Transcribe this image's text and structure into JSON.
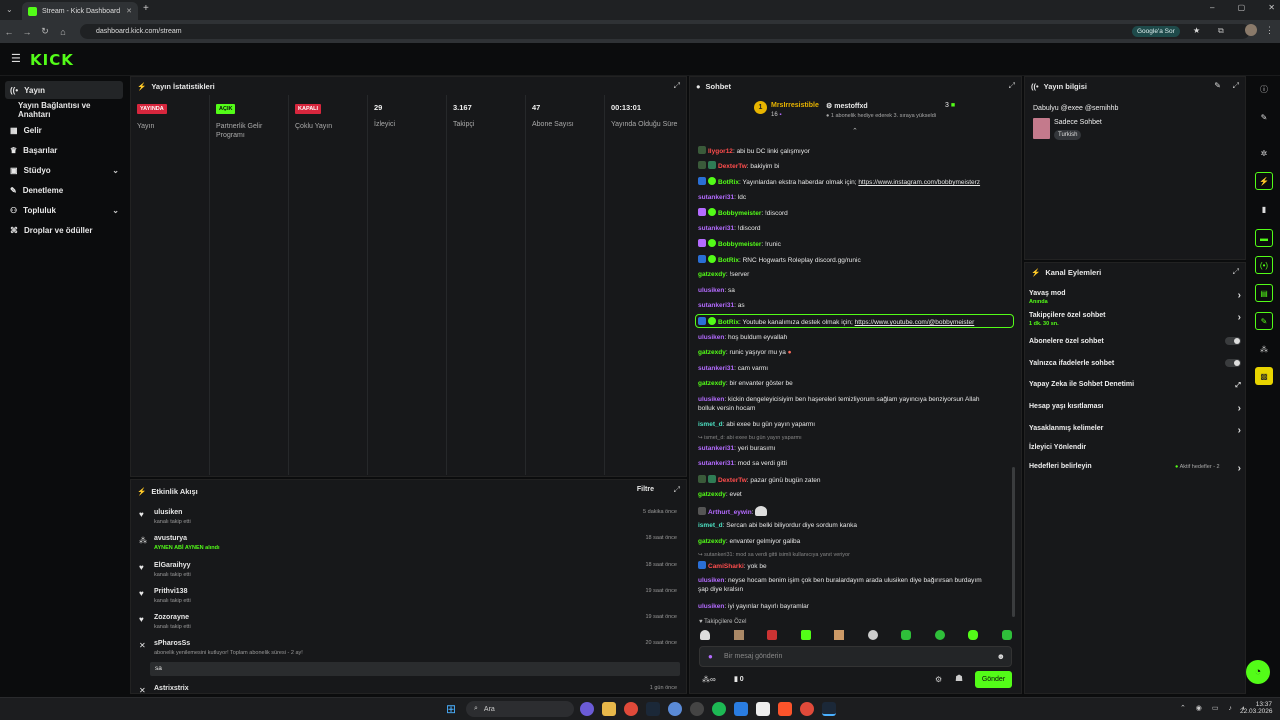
{
  "browser": {
    "tab_title": "Stream - Kick Dashboard",
    "url": "dashboard.kick.com/stream",
    "google_label": "Google'a Sor"
  },
  "header": {
    "logo": "KICK"
  },
  "sidebar": {
    "items": [
      {
        "label": "Yayın",
        "icon": "broadcast-icon"
      },
      {
        "label": "Yayın Bağlantısı ve Anahtarı",
        "icon": ""
      },
      {
        "label": "Gelir",
        "icon": "revenue-icon"
      },
      {
        "label": "Başarılar",
        "icon": "trophy-icon"
      },
      {
        "label": "Stüdyo",
        "icon": "studio-icon"
      },
      {
        "label": "Denetleme",
        "icon": "wrench-icon"
      },
      {
        "label": "Topluluk",
        "icon": "community-icon"
      },
      {
        "label": "Droplar ve ödüller",
        "icon": "gift-icon"
      }
    ]
  },
  "stats": {
    "title": "Yayın İstatistikleri",
    "items": [
      {
        "value": "YAYINDA",
        "label": "Yayın",
        "kind": "red"
      },
      {
        "value": "AÇIK",
        "label": "Partnerlik Gelir Programı",
        "kind": "green"
      },
      {
        "value": "KAPALI",
        "label": "Çoklu Yayın",
        "kind": "red"
      },
      {
        "value": "29",
        "label": "İzleyici",
        "kind": "num"
      },
      {
        "value": "3.167",
        "label": "Takipçi",
        "kind": "num"
      },
      {
        "value": "47",
        "label": "Abone Sayısı",
        "kind": "num"
      },
      {
        "value": "00:13:01",
        "label": "Yayında Olduğu Süre",
        "kind": "num"
      }
    ]
  },
  "activity": {
    "title": "Etkinlik Akışı",
    "filter": "Filtre",
    "items": [
      {
        "user": "ulusiken",
        "sub": "kanalı takip etti",
        "time": "5 dakika önce",
        "icon": "heart-icon"
      },
      {
        "user": "avusturya",
        "sub": "AYNEN ABİ AYNEN alındı",
        "time": "18 saat önce",
        "icon": "reward-icon"
      },
      {
        "user": "ElGaraihyy",
        "sub": "kanalı takip etti",
        "time": "18 saat önce",
        "icon": "heart-icon"
      },
      {
        "user": "Prithvi138",
        "sub": "kanalı takip etti",
        "time": "19 saat önce",
        "icon": "heart-icon"
      },
      {
        "user": "Zozorayne",
        "sub": "kanalı takip etti",
        "time": "19 saat önce",
        "icon": "heart-icon"
      },
      {
        "user": "sPharosSs",
        "sub": "abonelik yenilemesini kutluyor! Toplam abonelik süresi - 2 ay!",
        "time": "20 saat önce",
        "icon": "star-icon"
      }
    ],
    "sub_message": "sa",
    "cut_user": "Astrixstrix",
    "cut_time": "1 gün önce"
  },
  "chat": {
    "title": "Sohbet",
    "top_gifter": "MrsIrresistible",
    "top_gifter_count": "16",
    "gift_user": "mestoffxd",
    "gift_count": "3",
    "gift_msg": "1 abonelik hediye ederek 3. sıraya yükseldi",
    "messages": [
      {
        "user": "Ilygor12",
        "text": "abi bu DC linki çalışmıyor",
        "c": "r"
      },
      {
        "user": "DexterTw",
        "text": "bakiyim bi",
        "c": "r"
      },
      {
        "user": "BotRix",
        "text": "Yayınlardan ekstra haberdar olmak için; ",
        "link": "https://www.instagram.com/bobbymeisterz",
        "c": "g"
      },
      {
        "user": "sutankeri31",
        "text": "ldc",
        "c": "p"
      },
      {
        "user": "Bobbymeister",
        "text": "!discord",
        "c": "g"
      },
      {
        "user": "sutankeri31",
        "text": "!discord",
        "c": "p"
      },
      {
        "user": "Bobbymeister",
        "text": "!runic",
        "c": "g"
      },
      {
        "user": "BotRix",
        "text": "RNC Hogwarts Roleplay discord.gg/runic",
        "c": "g"
      },
      {
        "user": "gatzexdy",
        "text": "!server",
        "c": "g"
      },
      {
        "user": "ulusiken",
        "text": "sa",
        "c": "p"
      },
      {
        "user": "sutankeri31",
        "text": "as",
        "c": "p"
      },
      {
        "user": "BotRix",
        "text": "Youtube kanalımıza destek olmak için; ",
        "link": "https://www.youtube.com/@bobbymeister",
        "c": "g"
      },
      {
        "user": "ulusiken",
        "text": "hoş buldum eyvallah",
        "c": "p"
      },
      {
        "user": "gatzexdy",
        "text": "runic yaşıyor mu ya",
        "c": "g"
      },
      {
        "user": "sutankeri31",
        "text": "cam varmı",
        "c": "p"
      },
      {
        "user": "gatzexdy",
        "text": "bir envanter göster be",
        "c": "g"
      },
      {
        "user": "ulusiken",
        "text": "kickin dengeleyicisiyim ben haşereleri temizliyorum sağlam yayıncıya benziyorsun Allah",
        "cont": "bolluk versin hocam",
        "c": "p"
      },
      {
        "user": "ismet_d",
        "text": "abi exee bu gün yayın yaparmı",
        "c": "t"
      },
      {
        "user": "sutankeri31",
        "text": "yeri burasımı",
        "c": "p"
      },
      {
        "user": "sutankeri31",
        "text": "mod sa verdi gitti",
        "c": "p"
      },
      {
        "user": "DexterTw",
        "text": "pazar günü bugün zaten",
        "c": "r"
      },
      {
        "user": "gatzexdy",
        "text": "evet",
        "c": "g"
      },
      {
        "user": "Arthurt_eywin",
        "text": "",
        "c": "p"
      },
      {
        "user": "ismet_d",
        "text": "Sercan abi belki biliyordur diye sordum kanka",
        "c": "t"
      },
      {
        "user": "gatzexdy",
        "text": "envanter gelmiyor galiba",
        "c": "g"
      },
      {
        "user": "CamiSharki",
        "text": "yok be",
        "c": "r"
      },
      {
        "user": "ulusiken",
        "text": "neyse hocam benim işim çok ben buralardayım arada ulusiken diye bağırırsan burdayım",
        "cont": "şap diye kralsın",
        "c": "p"
      },
      {
        "user": "ulusiken",
        "text": "iyi yayınlar hayırlı bayramlar",
        "c": "p"
      }
    ],
    "reply1": "ismet_d: abi exee bu gün yayın yaparmı",
    "reply2": "sutankeri31: mod sa verdi gitti isimli kullanıcıya yanıt veriyor",
    "followers_label": "Takipçilere Özel",
    "placeholder": "Bir mesaj gönderin",
    "send": "Gönder",
    "points": "0"
  },
  "stream_info": {
    "title": "Yayın bilgisi",
    "stream_title": "Dabulyu @exee @semihhb",
    "category": "Sadece Sohbet",
    "tag": "Turkish"
  },
  "channel_actions": {
    "title": "Kanal Eylemleri",
    "items": [
      {
        "label": "Yavaş mod",
        "sub": "Anında",
        "ctrl": "arrow"
      },
      {
        "label": "Takipçilere özel sohbet",
        "sub": "1 dk. 30 sn.",
        "ctrl": "arrow"
      },
      {
        "label": "Abonelere özel sohbet",
        "sub": "",
        "ctrl": "toggle"
      },
      {
        "label": "Yalnızca ifadelerle sohbet",
        "sub": "",
        "ctrl": "toggle"
      },
      {
        "label": "Yapay Zeka ile Sohbet Denetimi",
        "sub": "",
        "ctrl": "popout"
      },
      {
        "label": "Hesap yaşı kısıtlaması",
        "sub": "",
        "ctrl": "arrow"
      },
      {
        "label": "Yasaklanmış kelimeler",
        "sub": "",
        "ctrl": "arrow"
      },
      {
        "label": "İzleyici Yönlendir",
        "sub": "",
        "ctrl": "none"
      },
      {
        "label": "Hedefleri belirleyin",
        "sub": "",
        "ctrl": "arrow"
      }
    ],
    "goals_note": "Aktif hedefler - 2"
  },
  "taskbar": {
    "search": "Ara",
    "time": "13:37",
    "date": "22.03.2026"
  },
  "colors": {
    "brand": "#53fc18",
    "live": "#d7263d"
  }
}
